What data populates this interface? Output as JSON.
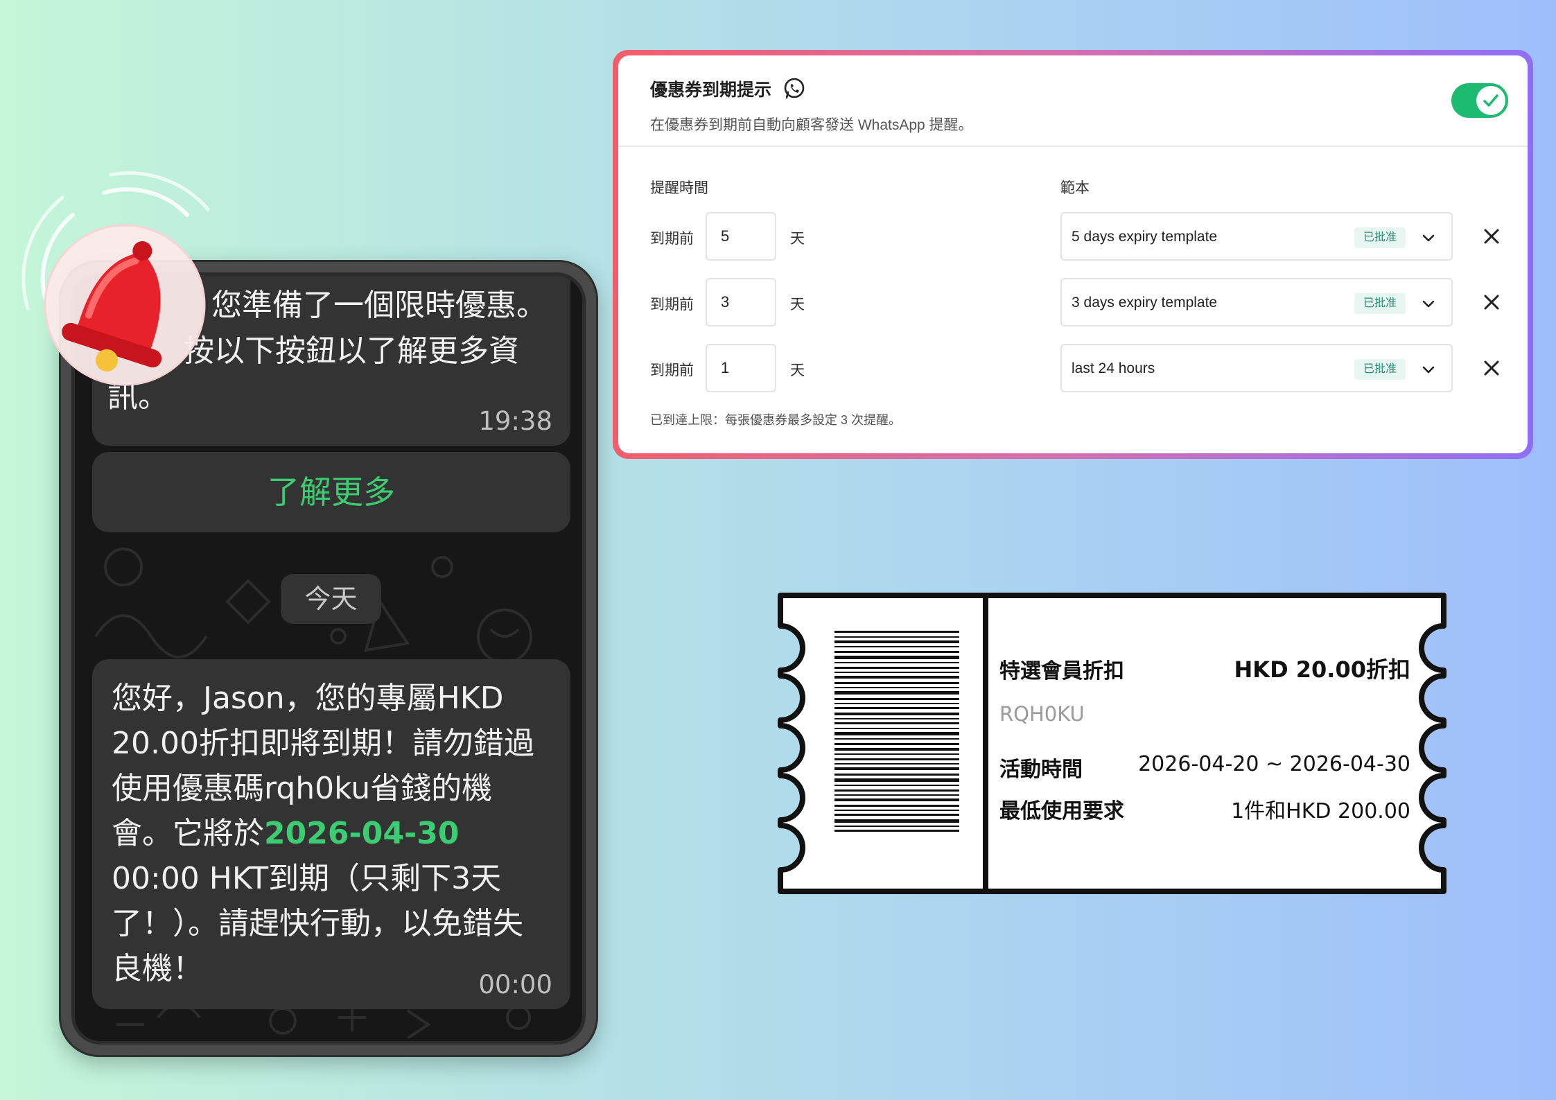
{
  "phone": {
    "top_message_line1": "您準備了一個限時優惠。",
    "top_message_line2": "按以下按鈕以了解更多資",
    "top_message_line3": "訊。",
    "top_time": "19:38",
    "learn_more_label": "了解更多",
    "date_chip": "今天",
    "message_part1": "您好，Jason，您的專屬HKD 20.00折扣即將到期！請勿錯過使用優惠碼rqh0ku省錢的機會。它將於",
    "message_highlight": "2026-04-30",
    "message_part2": " 00:00 HKT到期（只剩下3天了！）。請趕快行動，以免錯失良機！",
    "message_time": "00:00"
  },
  "settings": {
    "title": "優惠券到期提示",
    "subtitle": "在優惠券到期前自動向顧客發送 WhatsApp 提醒。",
    "toggle_on": true,
    "reminder_time_label": "提醒時間",
    "template_label": "範本",
    "before_label": "到期前",
    "days_unit": "天",
    "approved_badge": "已批准",
    "rows": [
      {
        "days": "5",
        "template": "5 days expiry template"
      },
      {
        "days": "3",
        "template": "3 days expiry template"
      },
      {
        "days": "1",
        "template": "last 24 hours"
      }
    ],
    "limit_note": "已到達上限：每張優惠券最多設定 3 次提醒。"
  },
  "coupon": {
    "name_label": "特選會員折扣",
    "discount": "HKD 20.00折扣",
    "code": "RQH0KU",
    "period_label": "活動時間",
    "period_value": "2026-04-20 ~ 2026-04-30",
    "min_label": "最低使用要求",
    "min_value": "1件和HKD 200.00"
  },
  "colors": {
    "toggle_green": "#1dbb72",
    "whatsapp_green": "#3ccc71",
    "bell_red": "#e8222b",
    "card_border_start": "#f35d6b",
    "card_border_end": "#8f6ff8"
  },
  "icons": [
    "bell-icon",
    "whatsapp-icon",
    "check-icon",
    "chevron-down-icon",
    "close-icon",
    "barcode-icon"
  ]
}
